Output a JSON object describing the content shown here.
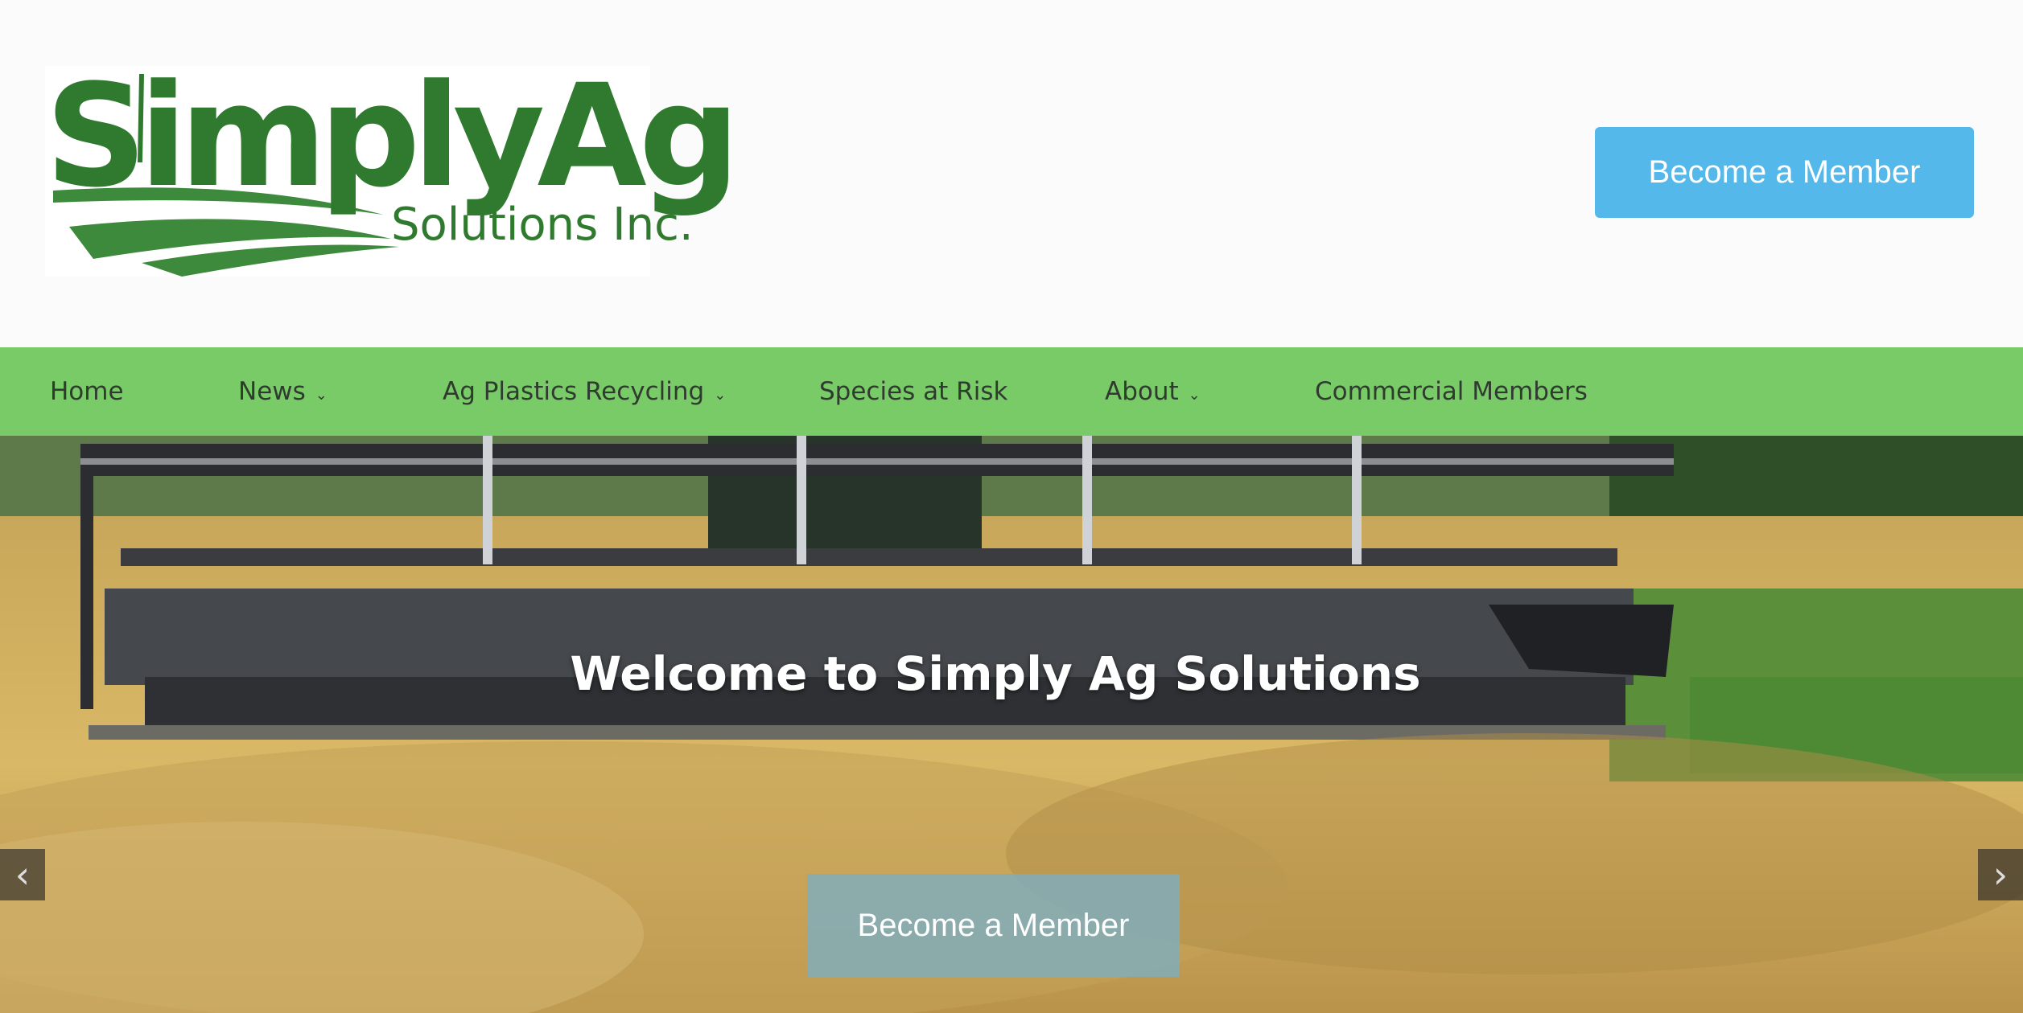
{
  "header": {
    "logo": {
      "main": "SimplyAg",
      "sub": "Solutions Inc."
    },
    "cta_label": "Become a Member"
  },
  "nav": {
    "items": [
      {
        "label": "Home",
        "has_dropdown": false
      },
      {
        "label": "News",
        "has_dropdown": true
      },
      {
        "label": "Ag Plastics Recycling",
        "has_dropdown": true
      },
      {
        "label": "Species at Risk",
        "has_dropdown": false
      },
      {
        "label": "About",
        "has_dropdown": true
      },
      {
        "label": "Commercial Members",
        "has_dropdown": false
      }
    ],
    "dropdown_glyph": "⌄"
  },
  "hero": {
    "title": "Welcome to Simply Ag Solutions",
    "cta_label": "Become a Member",
    "prev_glyph": "‹",
    "next_glyph": "›"
  },
  "colors": {
    "brand_green": "#2f7a2f",
    "nav_green": "#78cb67",
    "cta_blue": "#55b8ea"
  },
  "icons": {
    "prev": "chevron-left-icon",
    "next": "chevron-right-icon"
  }
}
